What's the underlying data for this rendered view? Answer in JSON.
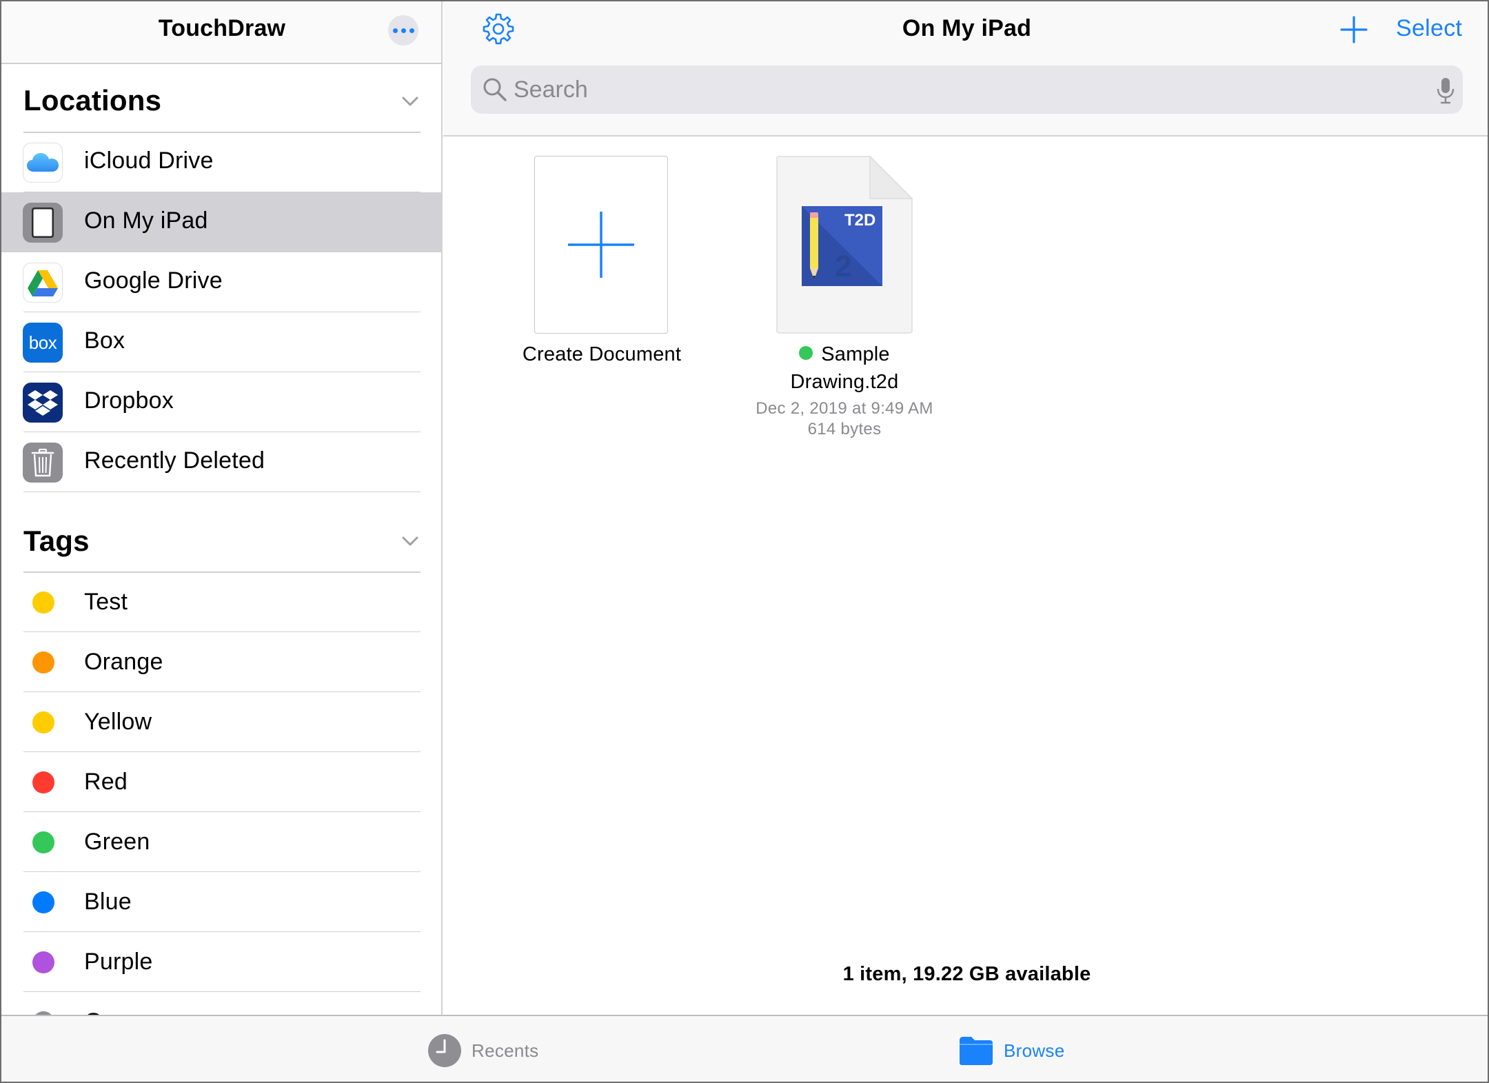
{
  "sidebar": {
    "title": "TouchDraw",
    "locations_title": "Locations",
    "locations": [
      {
        "label": "iCloud Drive",
        "icon": "icloud-icon"
      },
      {
        "label": "On My iPad",
        "icon": "ipad-icon",
        "selected": true
      },
      {
        "label": "Google Drive",
        "icon": "google-drive-icon"
      },
      {
        "label": "Box",
        "icon": "box-icon",
        "icon_text": "box"
      },
      {
        "label": "Dropbox",
        "icon": "dropbox-icon"
      },
      {
        "label": "Recently Deleted",
        "icon": "trash-icon"
      }
    ],
    "tags_title": "Tags",
    "tags": [
      {
        "label": "Test",
        "color": "#ffcc00"
      },
      {
        "label": "Orange",
        "color": "#ff9500"
      },
      {
        "label": "Yellow",
        "color": "#ffcc00"
      },
      {
        "label": "Red",
        "color": "#ff3b30"
      },
      {
        "label": "Green",
        "color": "#34c759"
      },
      {
        "label": "Blue",
        "color": "#007aff"
      },
      {
        "label": "Purple",
        "color": "#af52de"
      },
      {
        "label": "Gray",
        "color": "#8e8e93"
      }
    ]
  },
  "main": {
    "title": "On My iPad",
    "select_label": "Select",
    "search_placeholder": "Search",
    "create_label": "Create Document",
    "file": {
      "name_line1": "Sample",
      "name_line2": "Drawing.t2d",
      "thumb_text": "T2D",
      "date": "Dec 2, 2019 at 9:49 AM",
      "size": "614 bytes",
      "tag_color": "#34c759"
    },
    "status": "1 item, 19.22 GB available"
  },
  "tabbar": {
    "recents": "Recents",
    "browse": "Browse"
  },
  "colors": {
    "accent": "#1a82fb",
    "selected_row": "#d1d1d6"
  }
}
